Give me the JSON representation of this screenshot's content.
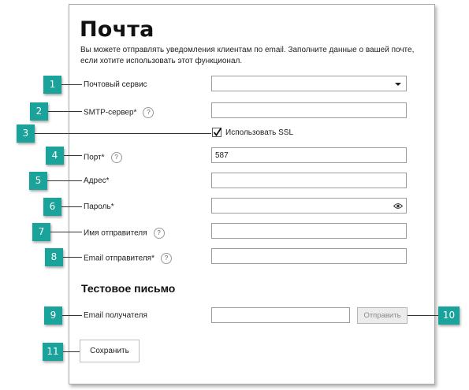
{
  "page": {
    "title": "Почта",
    "description": "Вы можете отправлять уведомления клиентам по email. Заполните данные о вашей почте, если хотите использовать этот функционал."
  },
  "fields": {
    "mail_service": {
      "label": "Почтовый сервис",
      "value": ""
    },
    "smtp_server": {
      "label": "SMTP-сервер*",
      "help": "?",
      "value": ""
    },
    "use_ssl": {
      "label": "Использовать SSL",
      "checked": true
    },
    "port": {
      "label": "Порт*",
      "help": "?",
      "value": "587"
    },
    "address": {
      "label": "Адрес*",
      "value": ""
    },
    "password": {
      "label": "Пароль*",
      "value": ""
    },
    "sender_name": {
      "label": "Имя отправителя",
      "help": "?",
      "value": ""
    },
    "sender_email": {
      "label": "Email отправителя*",
      "help": "?",
      "value": ""
    }
  },
  "test_email": {
    "section_title": "Тестовое письмо",
    "recipient_label": "Email получателя",
    "recipient_value": "",
    "send_button": "Отправить"
  },
  "save_button": "Сохранить",
  "callouts": [
    "1",
    "2",
    "3",
    "4",
    "5",
    "6",
    "7",
    "8",
    "9",
    "10",
    "11"
  ],
  "colors": {
    "callout": "#1aa39a",
    "border": "#9c9c9c"
  }
}
